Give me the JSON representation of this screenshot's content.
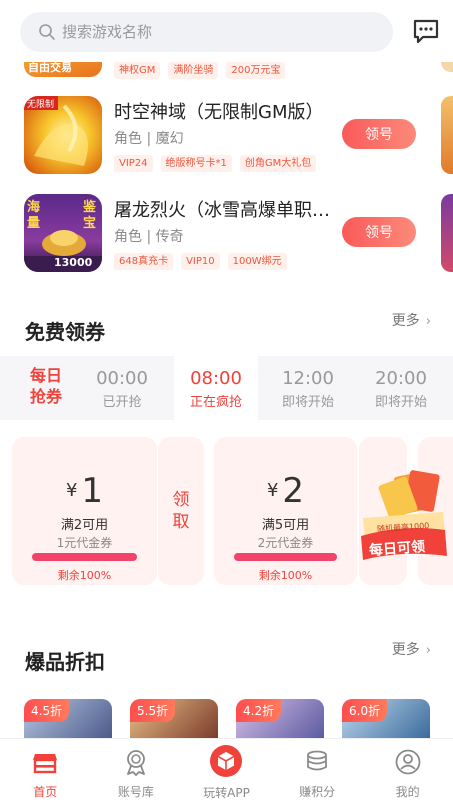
{
  "search": {
    "placeholder": "搜索游戏名称"
  },
  "partial_game": {
    "thumb_text": "自由交易",
    "tags": [
      "神权GM",
      "满阶坐骑",
      "200万元宝"
    ]
  },
  "games": [
    {
      "title": "时空神域（无限制GM版）",
      "categories": "角色 | 魔幻",
      "tags": [
        "VIP24",
        "绝版称号卡*1",
        "创角GM大礼包"
      ],
      "thumb_badge": "无限制",
      "button": "领号"
    },
    {
      "title": "屠龙烈火（冰雪高爆单职…",
      "categories": "角色 | 传奇",
      "tags": [
        "648真充卡",
        "VIP10",
        "100W绑元"
      ],
      "thumb_text_left": "海量",
      "thumb_text_right": "鉴宝",
      "thumb_bottom": "13000",
      "button": "领号"
    }
  ],
  "coupons_section": {
    "title": "免费领券",
    "more": "更多"
  },
  "daily": {
    "line1": "每日",
    "line2": "抢券"
  },
  "time_slots": [
    {
      "time": "00:00",
      "status": "已开抢",
      "active": false
    },
    {
      "time": "08:00",
      "status": "正在疯抢",
      "active": true
    },
    {
      "time": "12:00",
      "status": "即将开始",
      "active": false
    },
    {
      "time": "20:00",
      "status": "即将开始",
      "active": false
    }
  ],
  "coupons": [
    {
      "currency": "¥",
      "amount": "1",
      "condition": "满2可用",
      "name": "1元代金券",
      "remaining": "剩余100%",
      "remaining_fraction": 1.0
    },
    {
      "currency": "¥",
      "amount": "2",
      "condition": "满5可用",
      "name": "2元代金券",
      "remaining": "剩余100%",
      "remaining_fraction": 1.0
    }
  ],
  "claim_vertical": {
    "line1": "领",
    "line2": "取"
  },
  "promo": {
    "small_text": "随机最高1000",
    "big_text": "每日可领"
  },
  "discount_section": {
    "title": "爆品折扣",
    "more": "更多"
  },
  "discounts": [
    "4.5折",
    "5.5折",
    "4.2折",
    "6.0折"
  ],
  "nav": [
    {
      "label": "首页",
      "icon": "home-store-icon",
      "active": true
    },
    {
      "label": "账号库",
      "icon": "medal-icon",
      "active": false
    },
    {
      "label": "玩转APP",
      "icon": "cube-icon",
      "active": false
    },
    {
      "label": "赚积分",
      "icon": "coins-icon",
      "active": false
    },
    {
      "label": "我的",
      "icon": "user-icon",
      "active": false
    }
  ],
  "colors": {
    "accent": "#f0413a",
    "tag_bg": "#fff0ec",
    "coupon_bg": "#fff2f0",
    "bar": "#f2446a"
  }
}
